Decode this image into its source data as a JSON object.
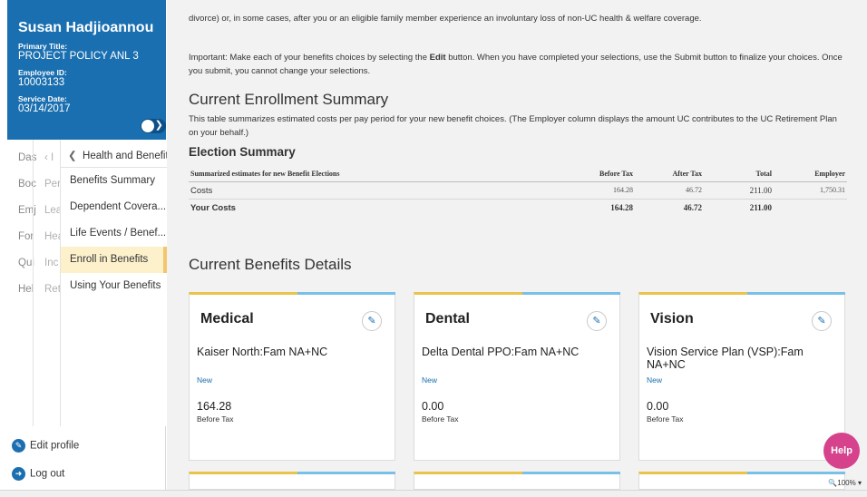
{
  "profile": {
    "name": "Susan Hadjioannou",
    "primary_title_label": "Primary Title:",
    "primary_title": "PROJECT POLICY ANL 3",
    "employee_id_label": "Employee ID:",
    "employee_id": "10003133",
    "service_date_label": "Service Date:",
    "service_date": "03/14/2017"
  },
  "nav": {
    "outer": [
      "Das",
      "Boc",
      "Emj",
      "For",
      "Qui",
      "Hel"
    ],
    "middle": [
      "‹ I",
      "Per",
      "Lea",
      "Hea",
      "Inc",
      "Ret"
    ],
    "inner_back_label": "Health and Benefits",
    "inner_items": [
      "Benefits Summary",
      "Dependent Covera...",
      "Life Events / Benef...",
      "Enroll in Benefits",
      "Using Your Benefits"
    ]
  },
  "footer_links": {
    "edit_profile": "Edit profile",
    "log_out": "Log out"
  },
  "main": {
    "intro": "divorce) or, in some cases, after you or an eligible family member experience an involuntary loss of non-UC health & welfare coverage.",
    "important_prefix": "Important: Make each of your benefits choices by selecting the ",
    "important_bold": "Edit",
    "important_suffix": " button. When you have completed your selections, use the Submit button to finalize your choices. Once you submit, you cannot change your selections.",
    "ces_heading": "Current Enrollment Summary",
    "ces_desc": "This table summarizes estimated costs per pay period for your new benefit choices. (The Employer column displays the amount UC contributes to the UC Retirement Plan on your behalf.)",
    "es_heading": "Election Summary",
    "cbd_heading": "Current Benefits Details"
  },
  "table": {
    "headers": {
      "label": "Summarized estimates for new Benefit Elections",
      "before_tax": "Before Tax",
      "after_tax": "After Tax",
      "total": "Total",
      "employer": "Employer"
    },
    "rows": [
      {
        "label": "Costs",
        "before_tax": "164.28",
        "after_tax": "46.72",
        "total": "211.00",
        "employer": "1,750.31"
      },
      {
        "label": "Your Costs",
        "before_tax": "164.28",
        "after_tax": "46.72",
        "total": "211.00",
        "employer": ""
      }
    ]
  },
  "cards": [
    {
      "title": "Medical",
      "plan": "Kaiser North:Fam NA+NC",
      "status": "New",
      "amount": "164.28",
      "amount_label": "Before Tax"
    },
    {
      "title": "Dental",
      "plan": "Delta Dental PPO:Fam NA+NC",
      "status": "New",
      "amount": "0.00",
      "amount_label": "Before Tax"
    },
    {
      "title": "Vision",
      "plan": "Vision Service Plan (VSP):Fam NA+NC",
      "status": "New",
      "amount": "0.00",
      "amount_label": "Before Tax"
    }
  ],
  "help_label": "Help",
  "zoom": "100%",
  "colors": {
    "brand_blue": "#1a6fb0",
    "active_highlight": "#fdf1cc",
    "card_top_yellow": "#e9c34a",
    "card_top_blue": "#79c0e8",
    "help_pink": "#d6428c"
  }
}
